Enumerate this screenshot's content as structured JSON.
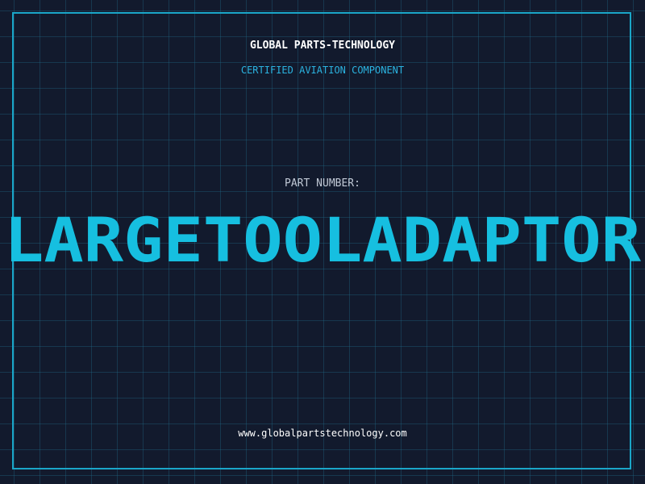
{
  "header": {
    "company_name": "GLOBAL PARTS-TECHNOLOGY",
    "subtitle": "CERTIFIED AVIATION COMPONENT"
  },
  "main": {
    "part_number_label": "PART NUMBER:",
    "part_number": "LARGETOOLADAPTOR"
  },
  "footer": {
    "website": "www.globalpartstechnology.com"
  },
  "colors": {
    "background": "#121a2d",
    "grid": "#20708c",
    "frame": "#1aa6c8",
    "accent": "#16bfe0",
    "text": "#ffffff"
  }
}
